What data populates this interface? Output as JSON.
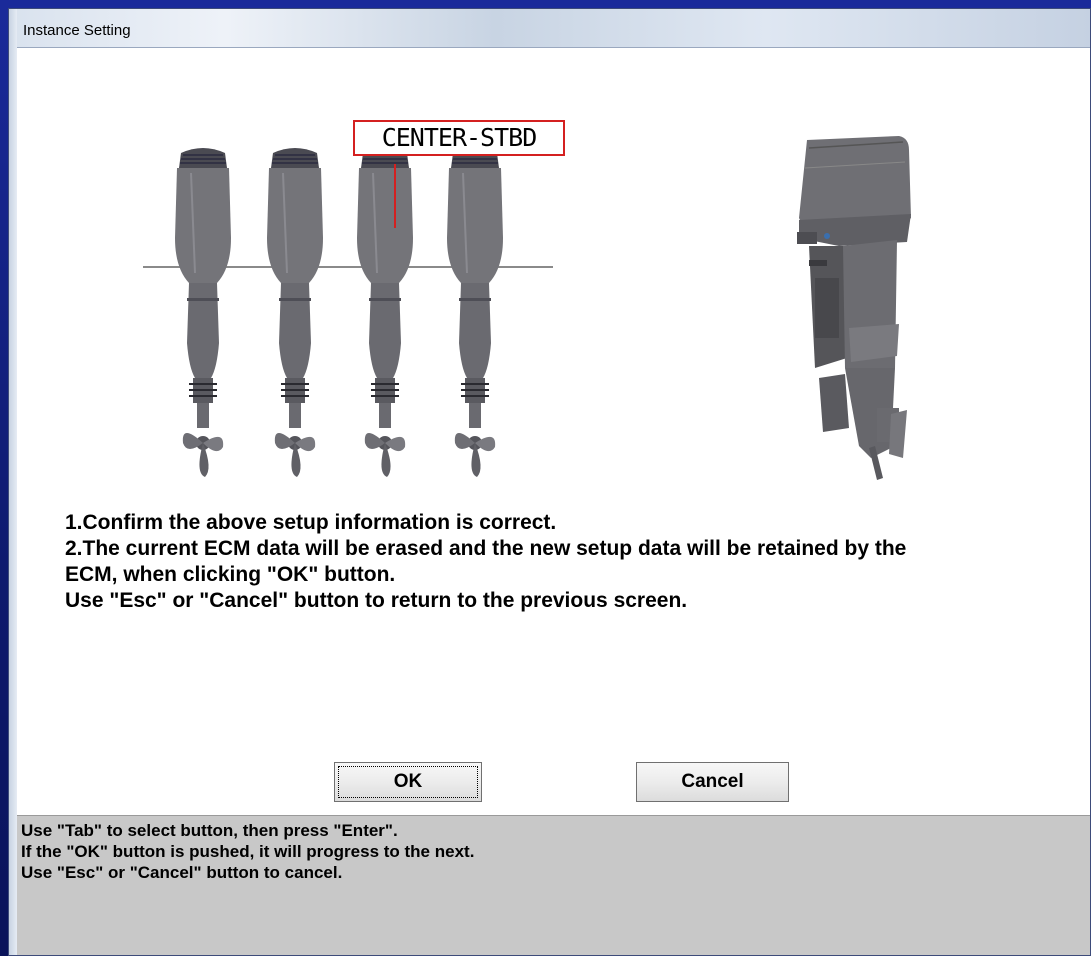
{
  "window": {
    "title": "Instance Setting"
  },
  "diagram": {
    "instance_label": "CENTER-STBD"
  },
  "instructions": {
    "line1": "1.Confirm the above setup information is correct.",
    "line2": "2.The current ECM data will be erased and the new setup data will be retained by the",
    "line3": "ECM, when clicking \"OK\" button.",
    "line4": "Use \"Esc\" or \"Cancel\" button to return to the previous screen."
  },
  "buttons": {
    "ok": "OK",
    "cancel": "Cancel"
  },
  "help": {
    "line1": "Use \"Tab\" to select button, then press \"Enter\".",
    "line2": "If the \"OK\" button is pushed, it will progress to the next.",
    "line3": "Use \"Esc\" or \"Cancel\" button to cancel."
  },
  "colors": {
    "highlight_border": "#d42020",
    "engine_gray": "#6f6f72",
    "help_background": "#c8c8c8"
  }
}
